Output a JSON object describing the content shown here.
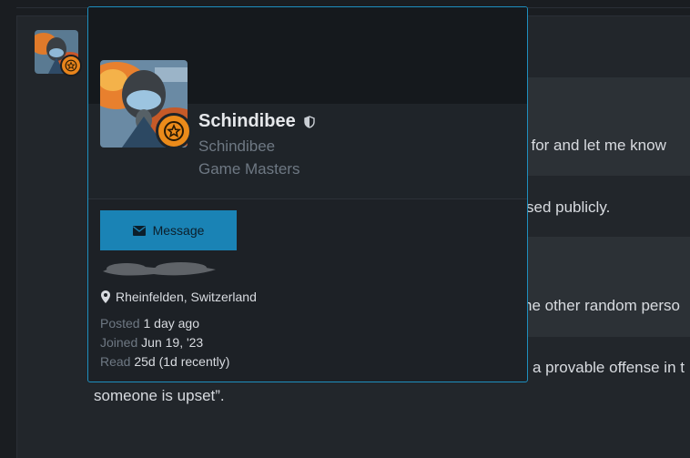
{
  "background": {
    "lines": [
      "l for and let me know",
      "sed publicly.",
      "he other random perso",
      "a provable offense in t",
      "someone is upset”."
    ]
  },
  "card": {
    "username": "Schindibee",
    "user_title": "Schindibee",
    "user_group": "Game Masters",
    "message_label": "Message",
    "location": "Rheinfelden, Switzerland",
    "stats": [
      {
        "label": "Posted",
        "value": "1 day ago"
      },
      {
        "label": "Joined",
        "value": "Jun 19, '23"
      },
      {
        "label": "Read",
        "value": "25d (1d recently)"
      }
    ]
  },
  "colors": {
    "accent": "#1a83b5",
    "card_border": "#1e8fbf",
    "badge": "#ec8b1a"
  }
}
